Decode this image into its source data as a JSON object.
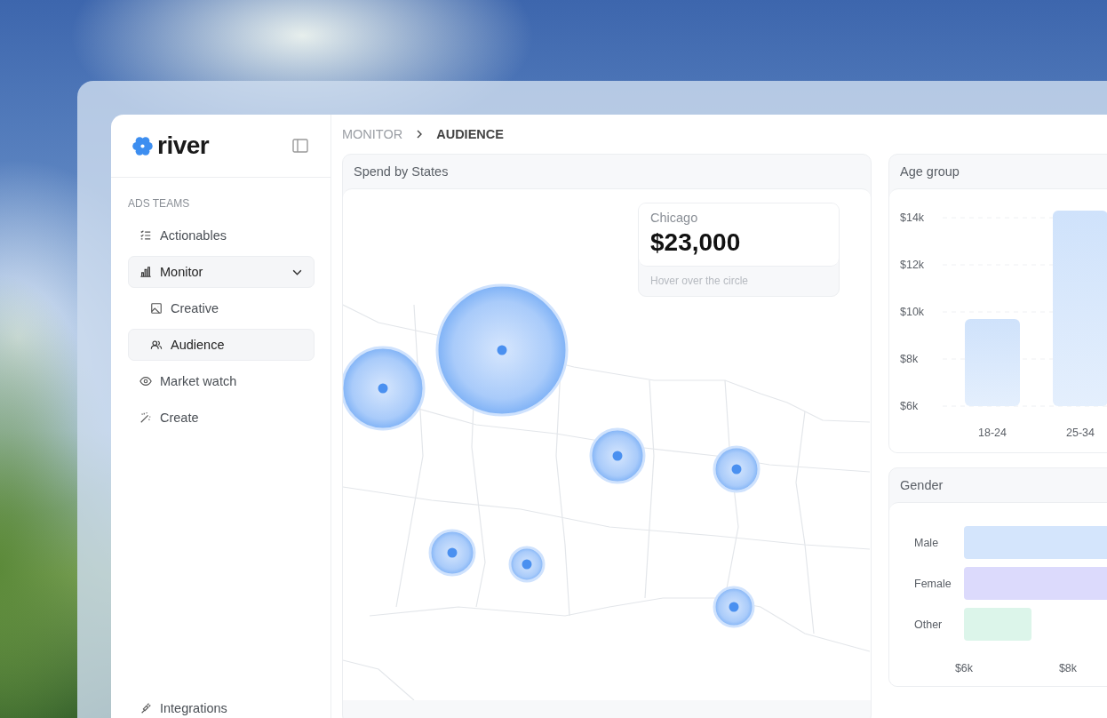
{
  "sidebar": {
    "logo": "river",
    "section_label": "ADS TEAMS",
    "items": [
      {
        "label": "Actionables",
        "selected": false
      },
      {
        "label": "Monitor",
        "selected": true,
        "expanded": true,
        "children": [
          {
            "label": "Creative",
            "selected": false
          },
          {
            "label": "Audience",
            "selected": true
          }
        ]
      },
      {
        "label": "Market watch",
        "selected": false
      },
      {
        "label": "Create",
        "selected": false
      }
    ],
    "footer_item": "Integrations"
  },
  "breadcrumb": [
    {
      "label": "MONITOR",
      "current": false
    },
    {
      "label": "AUDIENCE",
      "current": true
    }
  ],
  "spend_map": {
    "title": "Spend by States",
    "tooltip": {
      "city": "Chicago",
      "amount": "$23,000",
      "hint": "Hover over the circle"
    }
  },
  "age_group": {
    "title": "Age group",
    "chart_data": {
      "type": "bar",
      "categories": [
        "18-24",
        "25-34"
      ],
      "values": [
        9.7,
        14.3
      ],
      "ylim": [
        6,
        14.4
      ],
      "grid": true,
      "yticks": [
        {
          "value": 6,
          "label": "$6k"
        },
        {
          "value": 8,
          "label": "$8k"
        },
        {
          "value": 10,
          "label": "$10k"
        },
        {
          "value": 12,
          "label": "$12k"
        },
        {
          "value": 14,
          "label": "$14k"
        }
      ]
    }
  },
  "gender": {
    "title": "Gender",
    "chart_data": {
      "type": "bar",
      "orientation": "horizontal",
      "stacked": true,
      "categories": [
        "Male",
        "Female",
        "Other"
      ],
      "series": [
        {
          "color": "#d4e5fc",
          "values": [
            8.8,
            null,
            null
          ]
        },
        {
          "color": "#dcdafc",
          "values": [
            null,
            8.8,
            null
          ]
        },
        {
          "color": "#dcf5ea",
          "values": [
            null,
            null,
            7.3
          ]
        }
      ],
      "xlim": [
        6,
        8.8
      ],
      "xticks": [
        {
          "value": 6,
          "label": "$6k"
        },
        {
          "value": 8,
          "label": "$8k"
        }
      ]
    }
  }
}
